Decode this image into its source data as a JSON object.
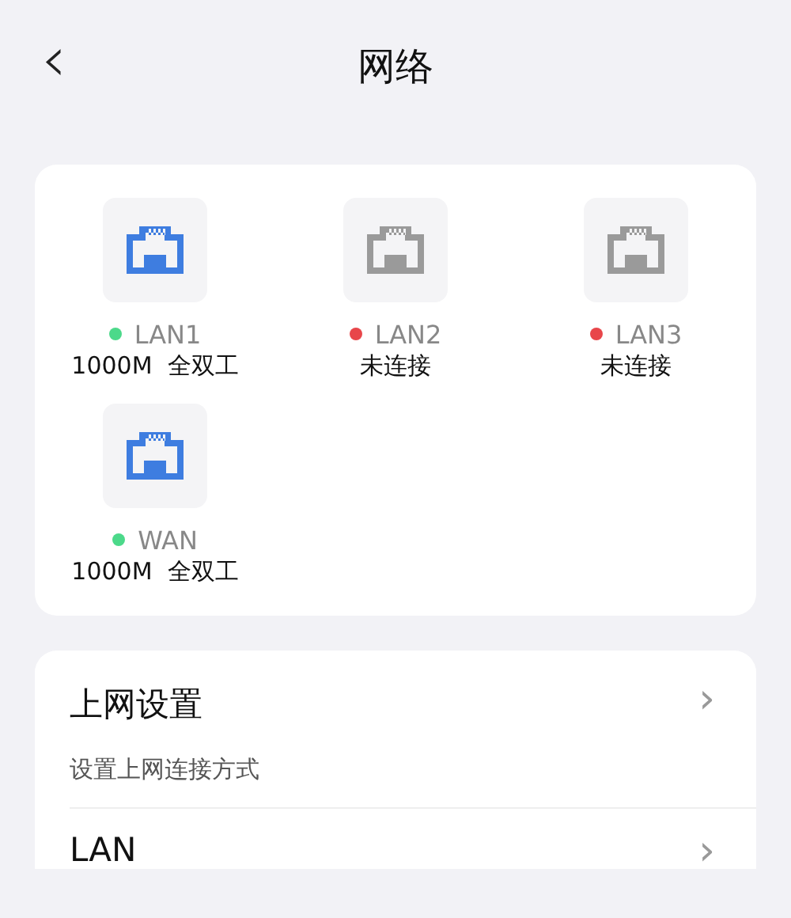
{
  "header": {
    "back": "‹",
    "title": "网络"
  },
  "ports": [
    {
      "name": "LAN1",
      "connected": true,
      "color": "#4cd98a",
      "info": "1000M  全双工"
    },
    {
      "name": "LAN2",
      "connected": false,
      "color": "#e8464a",
      "info": "未连接"
    },
    {
      "name": "LAN3",
      "connected": false,
      "color": "#e8464a",
      "info": "未连接"
    },
    {
      "name": "WAN",
      "connected": true,
      "color": "#4cd98a",
      "info": "1000M  全双工"
    }
  ],
  "settings": [
    {
      "title": "上网设置",
      "subtitle": "设置上网连接方式",
      "arrow": "›"
    },
    {
      "title": "LAN",
      "arrow": "›"
    }
  ]
}
